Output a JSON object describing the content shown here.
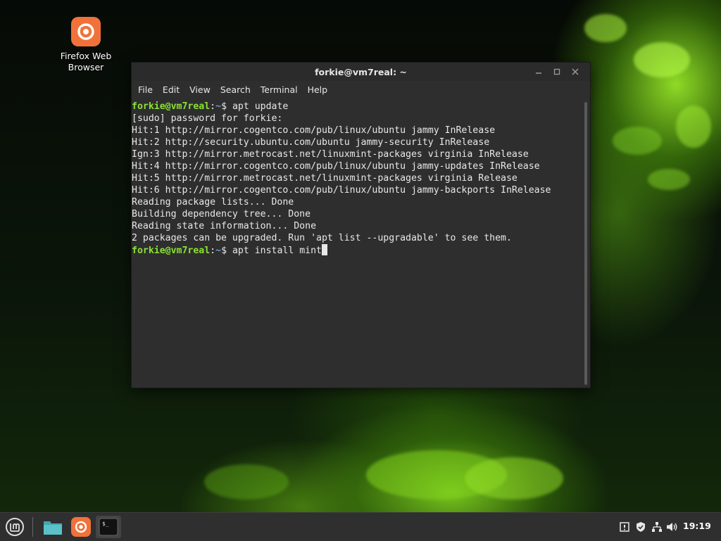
{
  "desktop": {
    "icons": [
      {
        "label": "Firefox Web Browser",
        "icon": "firefox-icon",
        "color": "#f0723a"
      }
    ]
  },
  "window": {
    "title": "forkie@vm7real: ~",
    "controls": {
      "minimize": "minimize-icon",
      "maximize": "maximize-icon",
      "close": "close-icon"
    },
    "menu": [
      "File",
      "Edit",
      "View",
      "Search",
      "Terminal",
      "Help"
    ]
  },
  "terminal": {
    "prompt_user": "forkie@vm7real",
    "prompt_sep": ":",
    "prompt_path": "~",
    "prompt_symbol": "$ ",
    "command_1": "apt update",
    "output": [
      "[sudo] password for forkie:",
      "Hit:1 http://mirror.cogentco.com/pub/linux/ubuntu jammy InRelease",
      "Hit:2 http://security.ubuntu.com/ubuntu jammy-security InRelease",
      "Ign:3 http://mirror.metrocast.net/linuxmint-packages virginia InRelease",
      "Hit:4 http://mirror.cogentco.com/pub/linux/ubuntu jammy-updates InRelease",
      "Hit:5 http://mirror.metrocast.net/linuxmint-packages virginia Release",
      "Hit:6 http://mirror.cogentco.com/pub/linux/ubuntu jammy-backports InRelease",
      "Reading package lists... Done",
      "Building dependency tree... Done",
      "Reading state information... Done",
      "2 packages can be upgraded. Run 'apt list --upgradable' to see them."
    ],
    "command_2": "apt install mint",
    "colors": {
      "user": "#8ae234",
      "path": "#6f9fd6",
      "background": "#2e2e2e",
      "text": "#e8e8e8"
    }
  },
  "taskbar": {
    "items": [
      "mint-menu-icon",
      "files-icon",
      "firefox-icon",
      "terminal-icon"
    ],
    "tray": [
      "update-manager-icon",
      "shield-icon",
      "network-icon",
      "volume-icon"
    ],
    "clock": "19:19"
  }
}
